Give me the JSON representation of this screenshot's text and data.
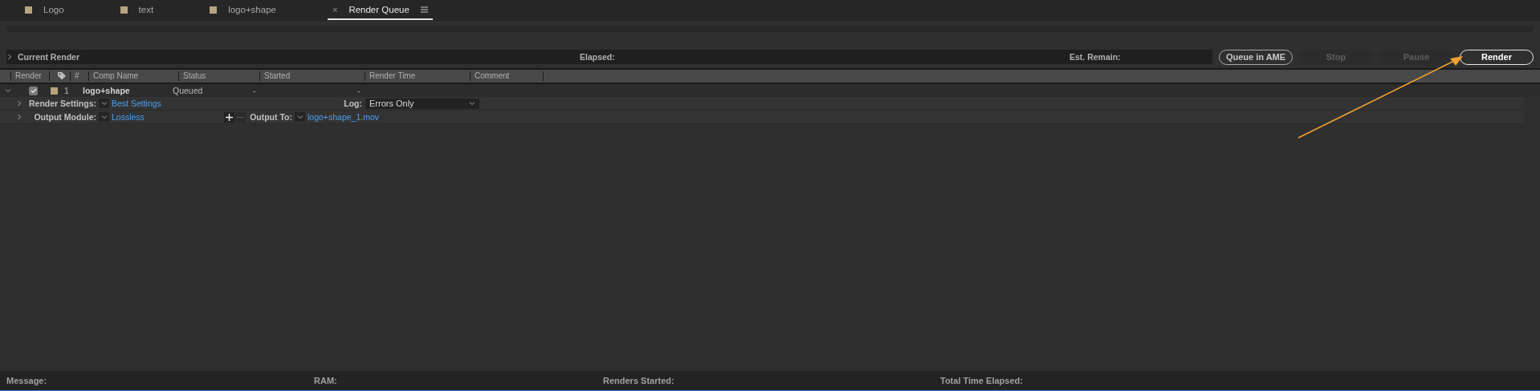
{
  "tabs": [
    {
      "label": "Logo",
      "kind": "comp",
      "selected": false,
      "color": "#b5a47e"
    },
    {
      "label": "text",
      "kind": "comp",
      "selected": false,
      "color": "#b5a47e"
    },
    {
      "label": "logo+shape",
      "kind": "comp",
      "selected": false,
      "color": "#b5a47e"
    },
    {
      "label": "Render Queue",
      "kind": "panel",
      "selected": true,
      "close": "×"
    }
  ],
  "progress": {
    "level": 0
  },
  "current_render": {
    "title": "Current Render",
    "elapsed_label": "Elapsed:",
    "remain_label": "Est. Remain:"
  },
  "buttons": [
    {
      "label": "Queue in AME",
      "disabled": false,
      "primary": false
    },
    {
      "label": "Stop",
      "disabled": true,
      "primary": false
    },
    {
      "label": "Pause",
      "disabled": true,
      "primary": false
    },
    {
      "label": "Render",
      "disabled": false,
      "primary": true
    }
  ],
  "table": {
    "columns": [
      "Render",
      "#",
      "Comp Name",
      "Status",
      "Started",
      "Render Time",
      "Comment"
    ],
    "rows": [
      {
        "expanded": true,
        "checked": true,
        "color": "#b5a47e",
        "number": "1",
        "comp_name": "logo+shape",
        "status": "Queued",
        "started": "-",
        "render_time": "-",
        "render_settings": {
          "label": "Render Settings:",
          "value": "Best Settings",
          "expanded": false
        },
        "log": {
          "label": "Log:",
          "value": "Errors Only"
        },
        "output_module": {
          "label": "Output Module:",
          "value": "Lossless",
          "expanded": false
        },
        "output_to": {
          "label": "Output To:",
          "value": "logo+shape_1.mov"
        }
      }
    ]
  },
  "status_bar": [
    "Message:",
    "RAM:",
    "Renders Started:",
    "Total Time Elapsed:"
  ]
}
